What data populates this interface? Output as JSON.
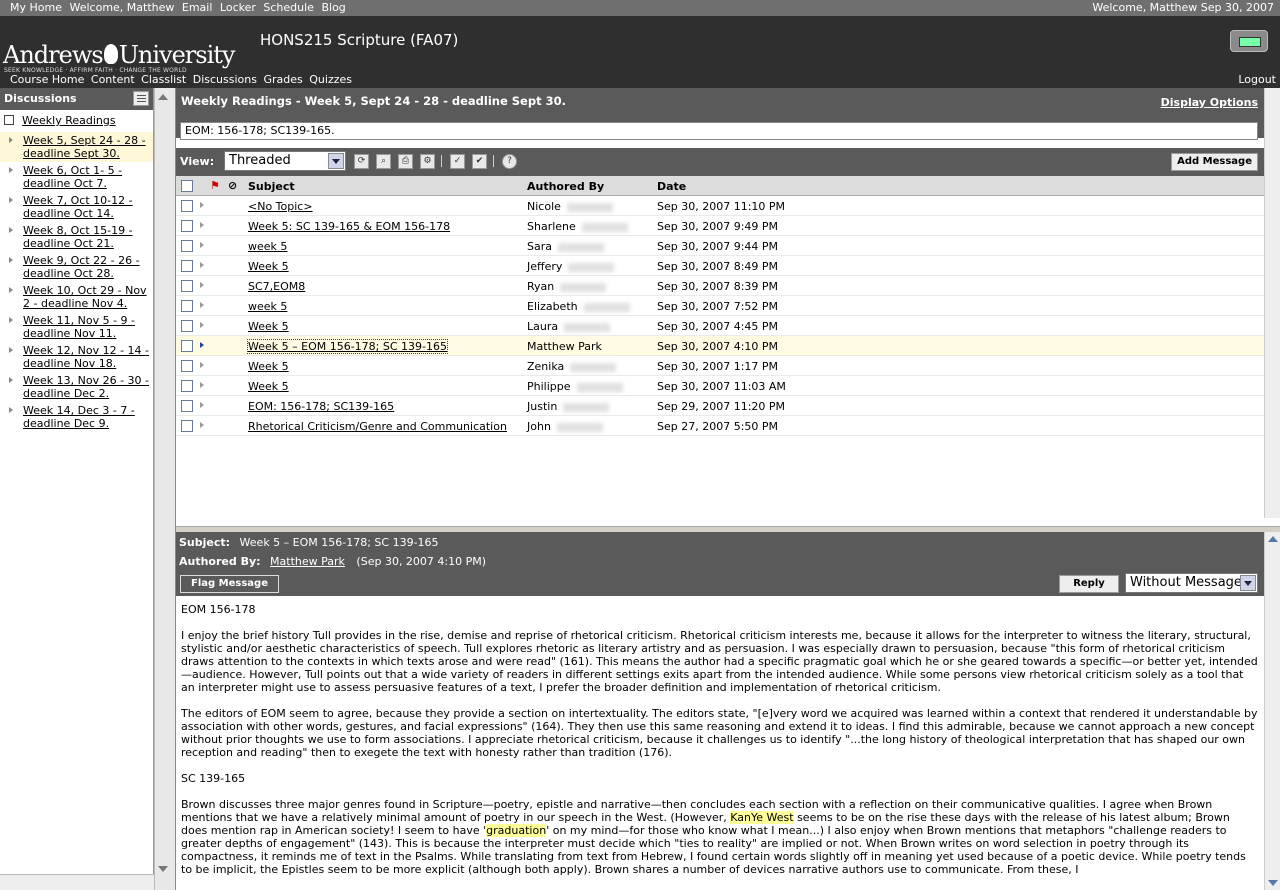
{
  "topbar": {
    "links": [
      "My Home",
      "Welcome, Matthew",
      "Email",
      "Locker",
      "Schedule",
      "Blog"
    ],
    "greeting": "Welcome, Matthew  Sep 30, 2007"
  },
  "header": {
    "logo_text": "Andrews University",
    "logo_left": "Andrews",
    "logo_right": "University",
    "tagline": "SEEK KNOWLEDGE · AFFIRM FAITH · CHANGE THE WORLD",
    "course_title": "HONS215 Scripture (FA07)",
    "nav": [
      "Course Home",
      "Content",
      "Classlist",
      "Discussions",
      "Grades",
      "Quizzes"
    ],
    "logout": "Logout"
  },
  "sidebar": {
    "title": "Discussions",
    "forum": "Weekly Readings",
    "topics": [
      "Week 5, Sept 24 - 28 - deadline Sept 30.",
      "Week 6, Oct 1- 5 - deadline Oct 7.",
      "Week 7, Oct 10-12 - deadline Oct 14.",
      "Week 8, Oct 15-19 - deadline Oct 21.",
      "Week 9, Oct 22 - 26 - deadline Oct 28.",
      "Week 10, Oct 29 - Nov 2 - deadline Nov 4.",
      "Week 11, Nov 5 - 9 - deadline Nov 11.",
      "Week 12, Nov 12 - 14 - deadline Nov 18.",
      "Week 13, Nov 26 - 30 - deadline Dec 2.",
      "Week 14, Dec 3 - 7 - deadline Dec 9."
    ]
  },
  "topic": {
    "title": "Weekly Readings - Week 5, Sept 24 - 28 - deadline Sept 30.",
    "display_options": "Display Options",
    "description": "EOM: 156-178; SC139-165."
  },
  "toolbar": {
    "view_label": "View:",
    "view_value": "Threaded",
    "add_message": "Add Message"
  },
  "list": {
    "headers": {
      "subject": "Subject",
      "author": "Authored By",
      "date": "Date"
    },
    "rows": [
      {
        "subject": "<No Topic>",
        "author": "Nicole",
        "date": "Sep 30, 2007 11:10 PM"
      },
      {
        "subject": "Week 5: SC 139-165 & EOM 156-178",
        "author": "Sharlene",
        "date": "Sep 30, 2007 9:49 PM"
      },
      {
        "subject": "week 5",
        "author": "Sara",
        "date": "Sep 30, 2007 9:44 PM"
      },
      {
        "subject": "Week 5",
        "author": "Jeffery",
        "date": "Sep 30, 2007 8:49 PM"
      },
      {
        "subject": "SC7,EOM8",
        "author": "Ryan",
        "date": "Sep 30, 2007 8:39 PM"
      },
      {
        "subject": "week 5",
        "author": "Elizabeth",
        "date": "Sep 30, 2007 7:52 PM"
      },
      {
        "subject": "Week 5",
        "author": "Laura",
        "date": "Sep 30, 2007 4:45 PM"
      },
      {
        "subject": "Week 5 – EOM 156-178; SC 139-165",
        "author": "Matthew Park",
        "date": "Sep 30, 2007 4:10 PM"
      },
      {
        "subject": "Week 5",
        "author": "Zenika",
        "date": "Sep 30, 2007 1:17 PM"
      },
      {
        "subject": "Week 5",
        "author": "Philippe",
        "date": "Sep 30, 2007 11:03 AM"
      },
      {
        "subject": "EOM: 156-178; SC139-165",
        "author": "Justin",
        "date": "Sep 29, 2007 11:20 PM"
      },
      {
        "subject": "Rhetorical Criticism/Genre and Communication",
        "author": "John",
        "date": "Sep 27, 2007 5:50 PM"
      }
    ]
  },
  "reader": {
    "subject_label": "Subject:",
    "subject": "Week 5 – EOM 156-178; SC 139-165",
    "author_label": "Authored By:",
    "author": "Matthew Park",
    "date": "(Sep 30, 2007 4:10 PM)",
    "flag": "Flag Message",
    "reply": "Reply",
    "reply_mode": "Without Message",
    "heading1": "EOM 156-178",
    "para1": "I enjoy the brief history Tull provides in the rise, demise and reprise of rhetorical criticism. Rhetorical criticism interests me, because it allows for the interpreter to witness the literary, structural, stylistic and/or aesthetic characteristics of speech. Tull explores rhetoric as literary artistry and as persuasion. I was especially drawn to persuasion, because \"this form of rhetorical criticism draws attention to the contexts in which texts arose and were read\" (161). This means the author had a specific pragmatic goal which he or she geared towards a specific—or better yet, intended—audience. However, Tull points out that a wide variety of readers in different settings exits apart from the intended audience. While some persons view rhetorical criticism solely as a tool that an interpreter might use to assess persuasive features of a text, I prefer the broader definition and implementation of rhetorical criticism.",
    "para2": "The editors of EOM seem to agree, because they provide a section on intertextuality. The editors state, \"[e]very word we acquired was learned within a context that rendered it understandable by association with other words, gestures, and facial expressions\" (164). They then use this same reasoning and extend it to ideas. I find this admirable, because we cannot approach a new concept without prior thoughts we use to form associations. I appreciate rhetorical criticism, because it challenges us to identify \"...the long history of theological interpretation that has shaped our own reception and reading\" then to exegete the text with honesty rather than tradition (176).",
    "heading2": "SC 139-165",
    "para3a": "Brown discusses three major genres found in Scripture—poetry, epistle and narrative—then concludes each section with a reflection on their communicative qualities. I agree when Brown mentions that we have a relatively minimal amount of poetry in our speech in the West. (However, ",
    "para3_hl1": "KanYe West",
    "para3b": " seems to be on the rise these days with the release of his latest album; Brown does mention rap in American society! I seem to have '",
    "para3_hl2": "graduation",
    "para3c": "' on my mind—for those who know what I mean...) I also enjoy when Brown mentions that metaphors \"challenge readers to greater depths of engagement\" (143). This is because the interpreter must decide which \"ties to reality\" are implied or not. When Brown writes on word selection in poetry through its compactness, it reminds me of text in the Psalms. While translating from text from Hebrew, I found certain words slightly off in meaning yet used because of a poetic device. While poetry tends to be implicit, the Epistles seem to be more explicit (although both apply). Brown shares a number of devices narrative authors use to communicate. From these, I"
  }
}
